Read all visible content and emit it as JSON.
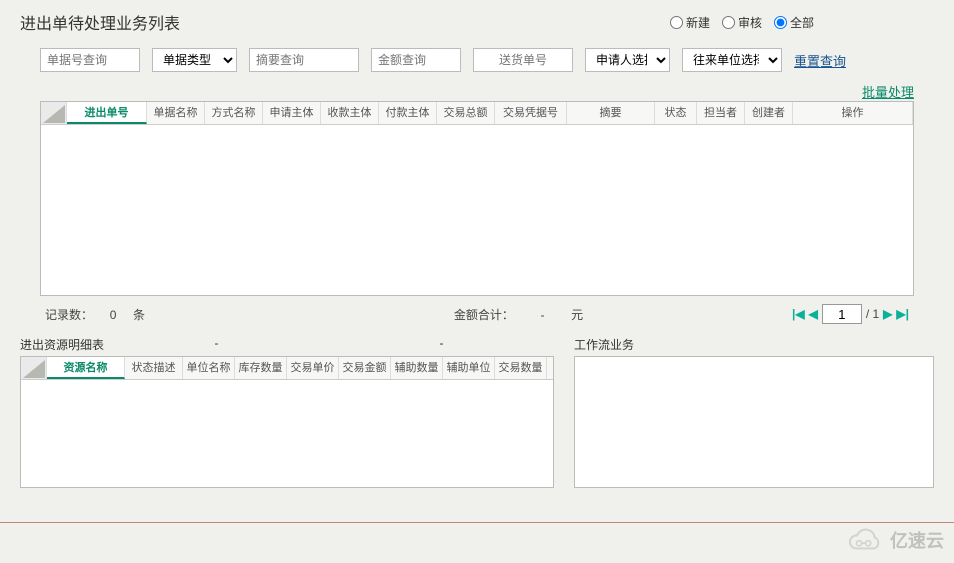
{
  "title": "进出单待处理业务列表",
  "radios": {
    "new": "新建",
    "audit": "审核",
    "all": "全部",
    "selected": "all"
  },
  "filters": {
    "docno": "单据号查询",
    "doctype": "单据类型",
    "summary": "摘要查询",
    "amount": "金额查询",
    "delivery": "送货单号",
    "applicant": "申请人选择",
    "partner": "往来单位选择",
    "reset": "重置查询",
    "batch": "批量处理"
  },
  "mainCols": [
    "进出单号",
    "单据名称",
    "方式名称",
    "申请主体",
    "收款主体",
    "付款主体",
    "交易总额",
    "交易凭据号",
    "摘要",
    "状态",
    "担当者",
    "创建者",
    "操作"
  ],
  "detailCols": [
    "资源名称",
    "状态描述",
    "单位名称",
    "库存数量",
    "交易单价",
    "交易金额",
    "辅助数量",
    "辅助单位",
    "交易数量"
  ],
  "status": {
    "records_label": "记录数：",
    "records_value": "0",
    "records_unit": "条",
    "amount_label": "金额合计：",
    "amount_value": "-",
    "amount_unit": "元",
    "page_current": "1",
    "page_total": "/ 1"
  },
  "lower": {
    "detail_title": "进出资源明细表",
    "dash1": "-",
    "dash2": "-",
    "workflow_title": "工作流业务"
  },
  "watermark": "亿速云"
}
